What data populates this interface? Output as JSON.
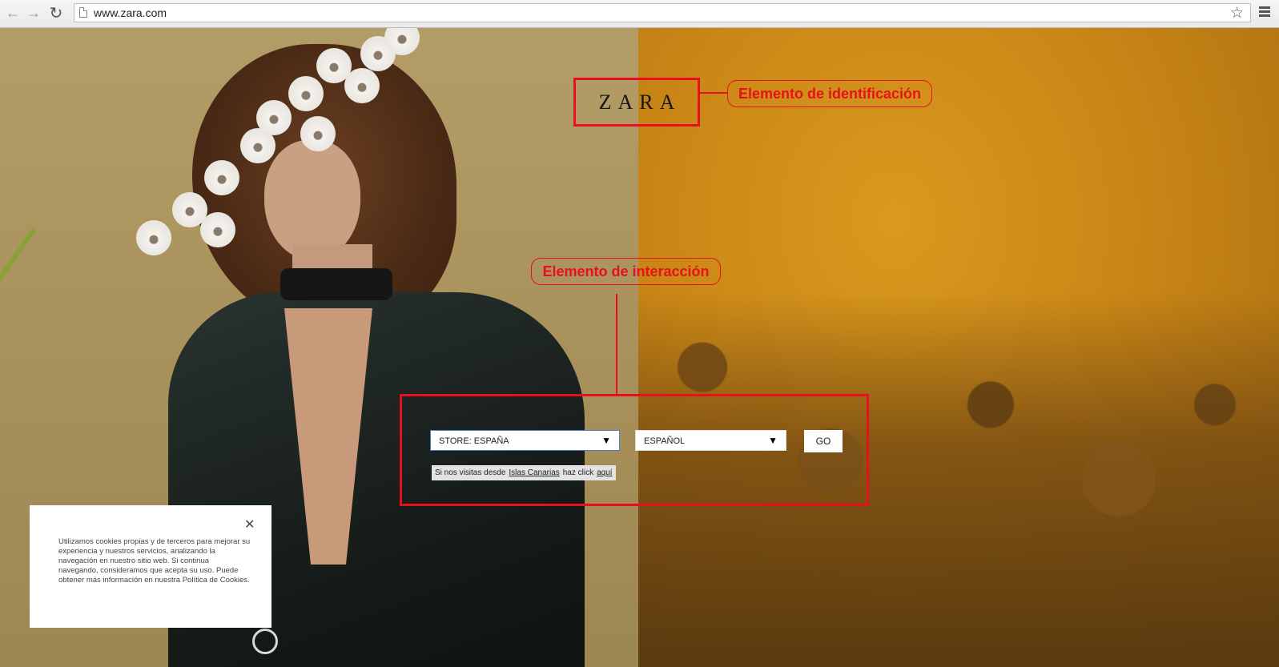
{
  "browser": {
    "url": "www.zara.com",
    "icons": {
      "back": "back-arrow-icon",
      "forward": "forward-arrow-icon",
      "reload": "reload-icon",
      "page": "page-icon",
      "bookmark": "star-icon",
      "menu": "hamburger-menu-icon"
    }
  },
  "header": {
    "logo_text": "ZARA"
  },
  "annotations": {
    "identification_label": "Elemento de identificación",
    "interaction_label": "Elemento de interacción",
    "color": "#e8101c"
  },
  "selector": {
    "store_label": "STORE: ESPAÑA",
    "language_label": "ESPAÑOL",
    "go_label": "GO",
    "note": {
      "prefix": "Si nos visitas desde",
      "link_region": "Islas Canarias",
      "middle": "haz click",
      "link_here": "aquí"
    }
  },
  "cookies": {
    "close_glyph": "✕",
    "text": "Utilizamos cookies propias y de terceros para mejorar su experiencia y nuestros servicios, analizando la navegación en nuestro sitio web. Si continua navegando, consideramos que acepta su uso. Puede obtener más información en nuestra Política de Cookies."
  },
  "colors": {
    "accent_annotation": "#e8101c",
    "store_select_border": "#4a7bd0"
  }
}
